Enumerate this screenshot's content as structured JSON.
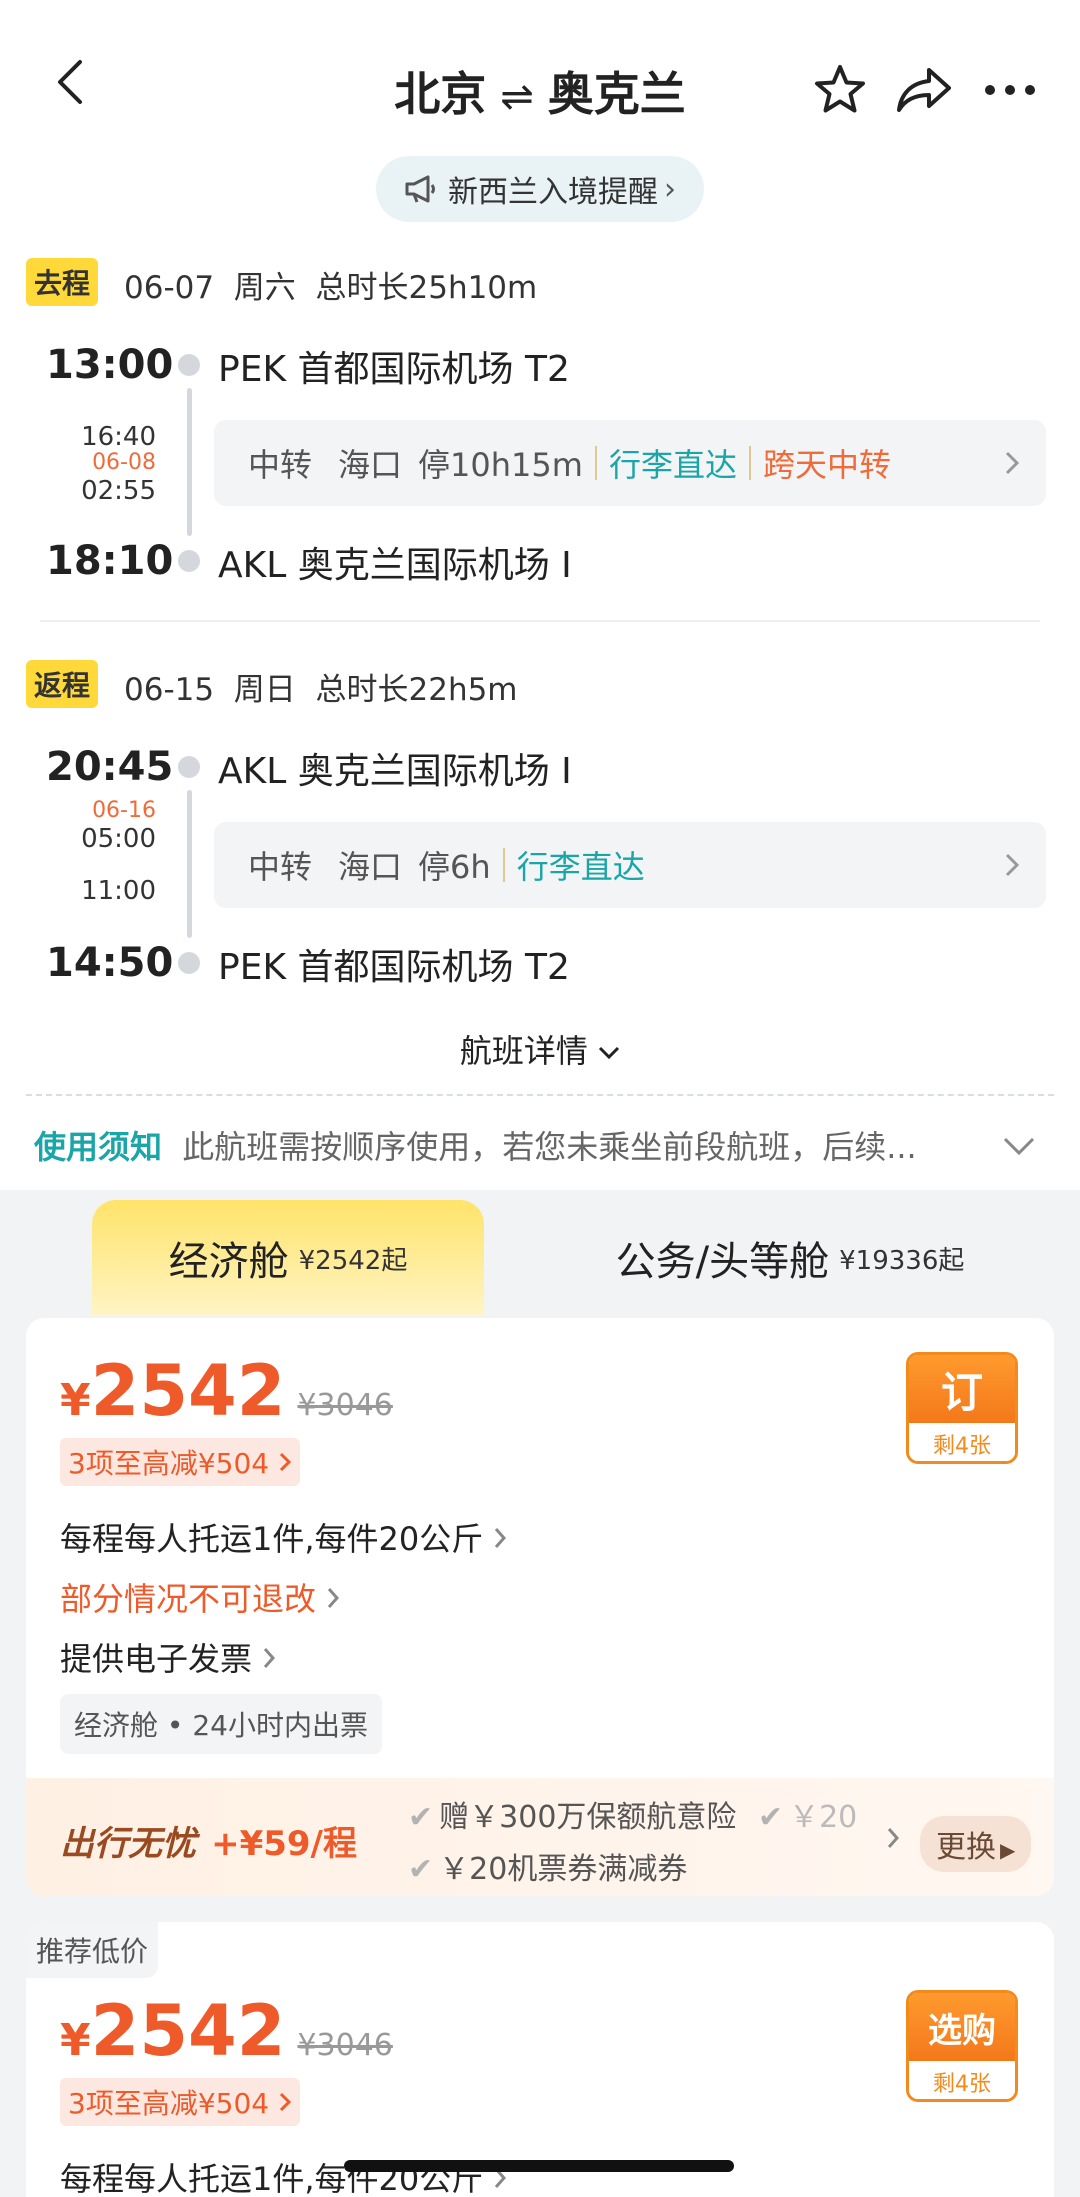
{
  "header": {
    "from": "北京",
    "swap": "⇌",
    "to": "奥克兰",
    "notice": "新西兰入境提醒",
    "notice_chevron": "›"
  },
  "outbound": {
    "tag": "去程",
    "summary": "06-07  周六  总时长25h10m",
    "dep_time": "13:00",
    "dep_airport": "PEK 首都国际机场 T2",
    "transit_arr_time": "16:40",
    "transit_date": "06-08",
    "transit_dep_time": "02:55",
    "transfer_label": "中转",
    "transfer_city": "海口",
    "transfer_stay": "停10h15m",
    "transfer_baggage": "行李直达",
    "transfer_extra": "跨天中转",
    "arr_time": "18:10",
    "arr_airport": "AKL 奥克兰国际机场 I"
  },
  "return": {
    "tag": "返程",
    "summary": "06-15  周日  总时长22h5m",
    "dep_time": "20:45",
    "dep_airport": "AKL 奥克兰国际机场 I",
    "transit_date": "06-16",
    "transit_arr_time": "05:00",
    "transit_dep_time": "11:00",
    "transfer_label": "中转",
    "transfer_city": "海口",
    "transfer_stay": "停6h",
    "transfer_baggage": "行李直达",
    "arr_time": "14:50",
    "arr_airport": "PEK 首都国际机场 T2"
  },
  "flight_detail": "航班详情",
  "usage": {
    "title": "使用须知",
    "text": "此航班需按顺序使用，若您未乘坐前段航班，后续..."
  },
  "tabs": [
    {
      "label": "经济舱",
      "price": "¥2542起"
    },
    {
      "label": "公务/头等舱",
      "price": "¥19336起"
    }
  ],
  "offer1": {
    "yen": "¥",
    "price": "2542",
    "old_price": "¥3046",
    "discount": "3项至高减¥504",
    "rule1": "每程每人托运1件,每件20公斤",
    "rule2": "部分情况不可退改",
    "rule3": "提供电子发票",
    "chip": "经济舱 • 24小时内出票",
    "btn": "订",
    "btn_sub": "剩4张"
  },
  "insurance": {
    "title": "出行无忧",
    "price": "+¥59/程",
    "item1": "赠￥300万保额航意险",
    "item1b": "￥20",
    "item2": "￥20机票券满减券",
    "change": "更换"
  },
  "offer2": {
    "badge": "推荐低价",
    "yen": "¥",
    "price": "2542",
    "old_price": "¥3046",
    "discount": "3项至高减¥504",
    "rule1": "每程每人托运1件,每件20公斤",
    "btn": "选购",
    "btn_sub": "剩4张"
  }
}
